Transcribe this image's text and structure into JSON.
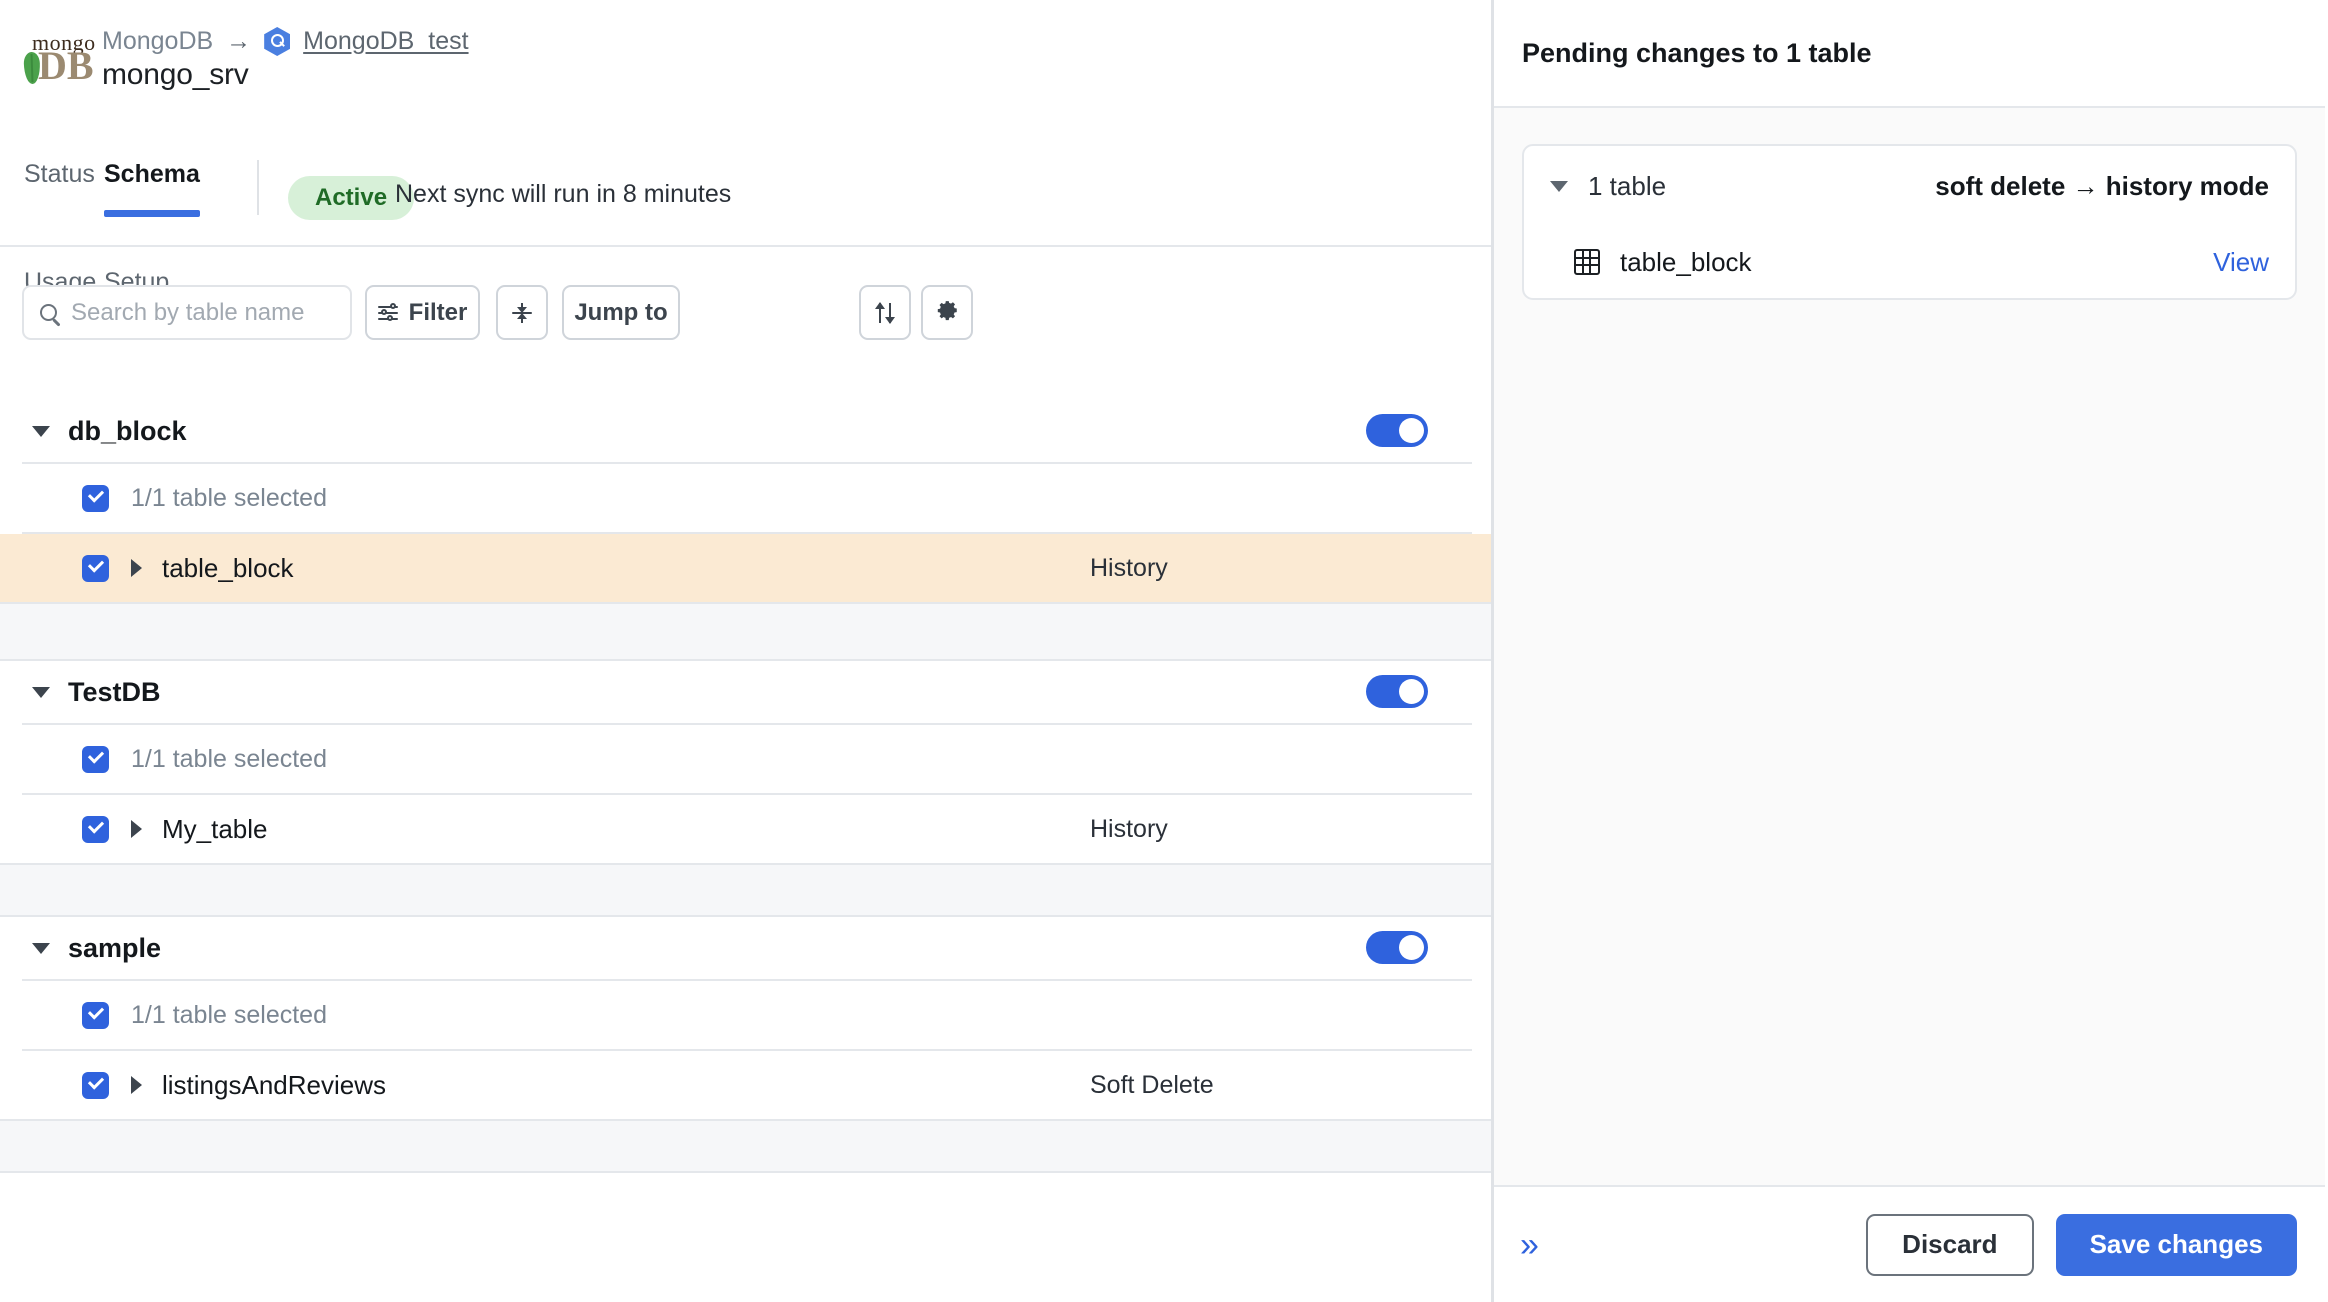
{
  "header": {
    "logo_mongo": "mongo",
    "logo_db": "DB",
    "breadcrumb_source": "MongoDB",
    "breadcrumb_arrow": "→",
    "breadcrumb_destination": "MongoDB_test",
    "destination_icon": "bigquery-hexagon-icon",
    "connector_title": "mongo_srv"
  },
  "tabs": [
    {
      "label": "Status",
      "active": false
    },
    {
      "label": "Schema",
      "active": true
    },
    {
      "label": "Usage",
      "active": false
    },
    {
      "label": "Setup",
      "active": false
    }
  ],
  "status": {
    "badge": "Active",
    "badge_bg": "#d7f0d8",
    "badge_fg": "#1f6b26",
    "sync_text": "Next sync will run in 8 minutes"
  },
  "toolbar": {
    "search_placeholder": "Search by table name",
    "search_value": "",
    "search_icon": "search-icon",
    "filter_label": "Filter",
    "filter_icon": "sliders-icon",
    "collapse_icon": "collapse-all-icon",
    "jump_to_label": "Jump to",
    "sort_icon": "sort-arrows-icon",
    "settings_icon": "gear-icon"
  },
  "schema": {
    "groups": [
      {
        "name": "db_block",
        "enabled": true,
        "selection_label": "1/1 table selected",
        "tables": [
          {
            "name": "table_block",
            "mode": "History",
            "selected": true,
            "highlighted": true
          }
        ]
      },
      {
        "name": "TestDB",
        "enabled": true,
        "selection_label": "1/1 table selected",
        "tables": [
          {
            "name": "My_table",
            "mode": "History",
            "selected": true,
            "highlighted": false
          }
        ]
      },
      {
        "name": "sample",
        "enabled": true,
        "selection_label": "1/1 table selected",
        "tables": [
          {
            "name": "listingsAndReviews",
            "mode": "Soft Delete",
            "selected": true,
            "highlighted": false
          }
        ]
      }
    ]
  },
  "pending_panel": {
    "title": "Pending changes to 1 table",
    "group": {
      "count_label": "1 table",
      "change_label": "soft delete → history mode",
      "rows": [
        {
          "table_icon": "table-grid-icon",
          "name": "table_block",
          "action_label": "View"
        }
      ]
    },
    "footer": {
      "collapse_icon": "chevron-double-right-icon",
      "collapse_glyph": "»",
      "discard_label": "Discard",
      "save_label": "Save changes",
      "accent_color": "#3a6ee0"
    }
  }
}
